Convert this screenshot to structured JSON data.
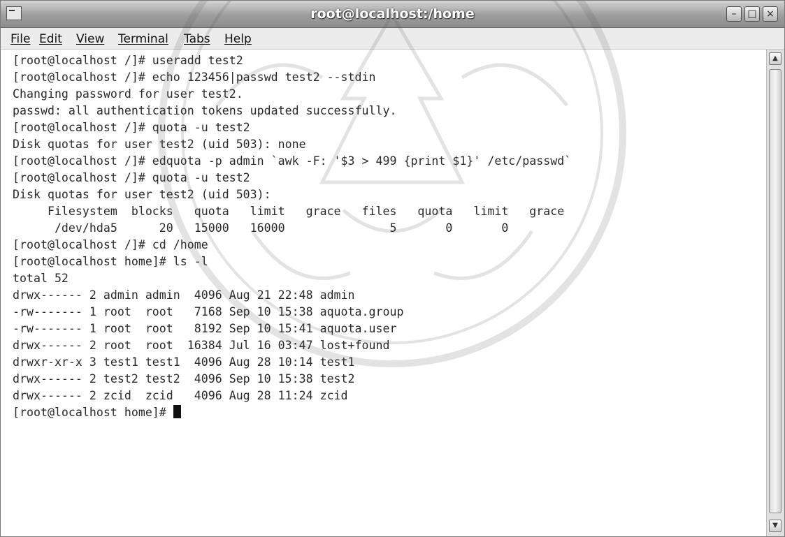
{
  "window": {
    "title": "root@localhost:/home",
    "buttons": {
      "minimize": "–",
      "maximize": "□",
      "close": "×"
    }
  },
  "menubar": {
    "items": [
      "File",
      "Edit",
      "View",
      "Terminal",
      "Tabs",
      "Help"
    ]
  },
  "terminal": {
    "lines": [
      "[root@localhost /]# useradd test2",
      "[root@localhost /]# echo 123456|passwd test2 --stdin",
      "Changing password for user test2.",
      "passwd: all authentication tokens updated successfully.",
      "[root@localhost /]# quota -u test2",
      "Disk quotas for user test2 (uid 503): none",
      "[root@localhost /]# edquota -p admin `awk -F: '$3 > 499 {print $1}' /etc/passwd`",
      "[root@localhost /]# quota -u test2",
      "Disk quotas for user test2 (uid 503):",
      "     Filesystem  blocks   quota   limit   grace   files   quota   limit   grace",
      "      /dev/hda5      20   15000   16000               5       0       0",
      "[root@localhost /]# cd /home",
      "[root@localhost home]# ls -l",
      "total 52",
      "drwx------ 2 admin admin  4096 Aug 21 22:48 admin",
      "-rw------- 1 root  root   7168 Sep 10 15:38 aquota.group",
      "-rw------- 1 root  root   8192 Sep 10 15:41 aquota.user",
      "drwx------ 2 root  root  16384 Jul 16 03:47 lost+found",
      "drwxr-xr-x 3 test1 test1  4096 Aug 28 10:14 test1",
      "drwx------ 2 test2 test2  4096 Sep 10 15:38 test2",
      "drwx------ 2 zcid  zcid   4096 Aug 28 11:24 zcid"
    ],
    "prompt": "[root@localhost home]# "
  }
}
